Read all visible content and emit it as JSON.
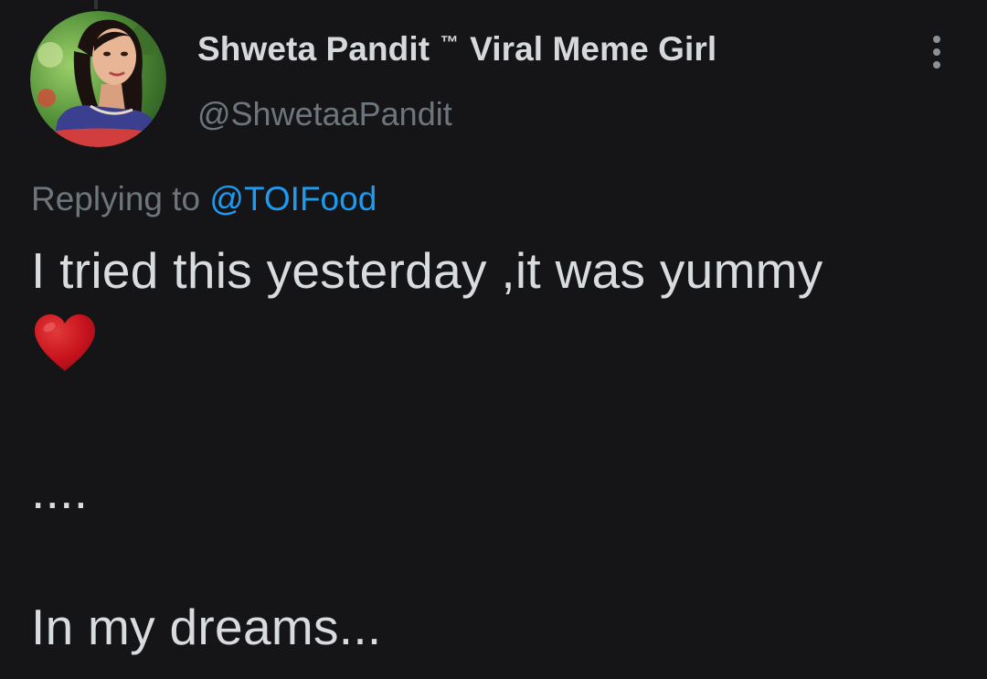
{
  "tweet": {
    "author": {
      "display_name": "Shweta Pandit",
      "trademark": "™",
      "display_name_suffix": "Viral Meme Girl",
      "handle": "@ShwetaaPandit",
      "avatar_icon": "profile-photo"
    },
    "more_icon": "vertical-ellipsis-icon",
    "reply_context": {
      "prefix": "Replying to",
      "mention": "@TOIFood"
    },
    "body": {
      "line1": "I tried this yesterday ,it was yummy",
      "emoji": "heart-emoji",
      "line2": "....",
      "line3": "In my dreams..."
    }
  },
  "colors": {
    "background": "#151517",
    "text": "#d9dcdf",
    "secondary_text": "#6e767d",
    "link": "#1d9bf0",
    "heart": "#c8141e"
  }
}
